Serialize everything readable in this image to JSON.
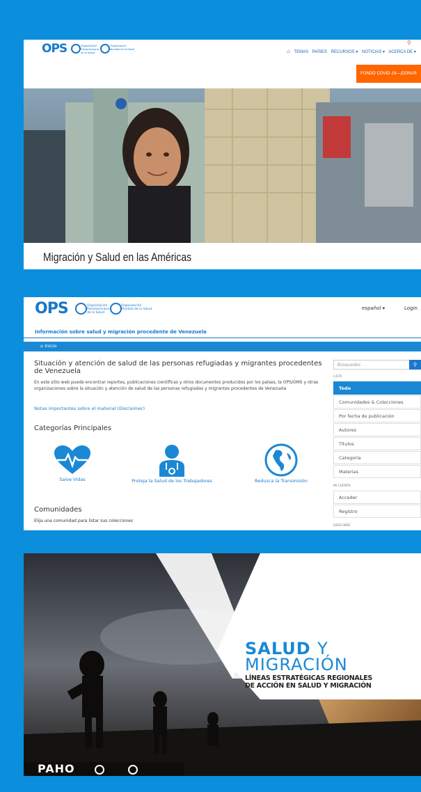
{
  "panel1": {
    "logo_text": "OPS",
    "org_lines": [
      "Organización",
      "Panamericana",
      "de la Salud"
    ],
    "who_lines": [
      "Organización",
      "Mundial de la Salud"
    ],
    "nav": [
      "TEMAS",
      "PAÍSES",
      "RECURSOS ▾",
      "NOTICIAS ▾",
      "ACERCA DE ▾"
    ],
    "covid_button": "FONDO COVID-19—¡DONAR AHORA!",
    "hero_title": "Migración y Salud en las Américas"
  },
  "panel2": {
    "logo_text": "OPS",
    "language": "español ▾",
    "login": "Login",
    "site_title": "Información sobre salud y migración procedente de Venezuela",
    "breadcrumb": "Inicio",
    "main_title": "Situación y atención de salud de las personas refugiadas y migrantes procedentes de Venezuela",
    "main_desc": "En este sitio web puede encontrar reportes, publicaciones científicas y otros documentos producidos por los países, la OPS/OMS y otras organizaciones sobre la situación y atención de salud de las personas refugiadas y migrantes procedentes de Venezuela",
    "notes_link": "Notas importantes sobre el material (Disclaimer)",
    "categories_title": "Categorías Principales",
    "categories": [
      "Salve Vidas",
      "Proteja la Salud de los Trabajadores",
      "Reduzca la Transmisión"
    ],
    "communities_title": "Comunidades",
    "communities_desc": "Elija una comunidad para listar sus colecciones",
    "sidebar": {
      "search_placeholder": "Búsquedas",
      "list_label": "LISTA",
      "list_items": [
        "Todo",
        "Comunidades & Colecciones",
        "Por fecha de publicación",
        "Autores",
        "Títulos",
        "Categoría",
        "Materias"
      ],
      "account_label": "MI CUENTA",
      "account_items": [
        "Acceder",
        "Registro"
      ],
      "discover_label": "DESCUBRE"
    }
  },
  "panel3": {
    "title_bold": "SALUD",
    "title_y": "Y",
    "title_line2": "MIGRACIÓN",
    "subtitle_line1": "LÍNEAS ESTRATÉGICAS REGIONALES",
    "subtitle_line2": "DE ACCIÓN EN SALUD Y MIGRACIÓN",
    "paho_logo": "PAHO"
  },
  "colors": {
    "background": "#0b8fdc",
    "brand_blue": "#1a78c8",
    "covid_orange": "#ff6600"
  }
}
